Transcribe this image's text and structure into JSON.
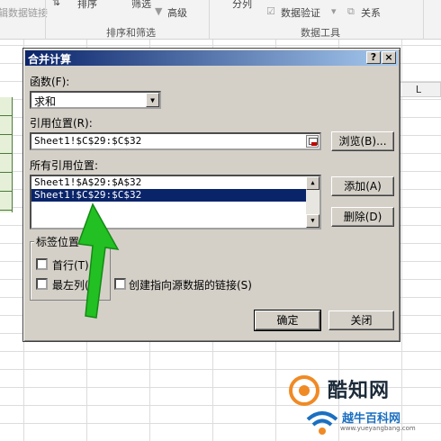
{
  "ribbon": {
    "group_left_partial": "辑数据链接",
    "sort_label": "排序",
    "filter_label": "筛选",
    "advanced_label": "高级",
    "split_label": "分列",
    "data_validation_label": "数据验证",
    "relations_label": "关系",
    "sort_filter_group": "排序和筛选",
    "data_tools_group": "数据工具"
  },
  "sheet": {
    "column_header": "L"
  },
  "dialog": {
    "title": "合并计算",
    "help_button": "?",
    "close_button": "×",
    "function_label": "函数(F):",
    "function_value": "求和",
    "reference_label": "引用位置(R):",
    "reference_value": "Sheet1!$C$29:$C$32",
    "browse_button": "浏览(B)...",
    "all_references_label": "所有引用位置:",
    "all_references": [
      {
        "text": "Sheet1!$A$29:$A$32",
        "selected": false
      },
      {
        "text": "Sheet1!$C$29:$C$32",
        "selected": true
      }
    ],
    "add_button": "添加(A)",
    "delete_button": "删除(D)",
    "use_labels_group": "标签位置",
    "top_row_label": "首行(T)",
    "left_column_label": "最左列(L)",
    "link_source_label": "创建指向源数据的链接(S)",
    "ok_button": "确定",
    "close_dialog_button": "关闭",
    "checkboxes": {
      "top_row": false,
      "left_column": false,
      "link_source": false
    }
  },
  "annotation": {
    "arrow_color": "#22c022"
  },
  "watermark": {
    "brand": "酷知网",
    "site_cn": "越牛百科网",
    "site_url": "www.yueyangbang.com"
  },
  "colors": {
    "dialog_face": "#d4d0c8",
    "titlebar": "#0a246a",
    "selection": "#0a246a"
  }
}
